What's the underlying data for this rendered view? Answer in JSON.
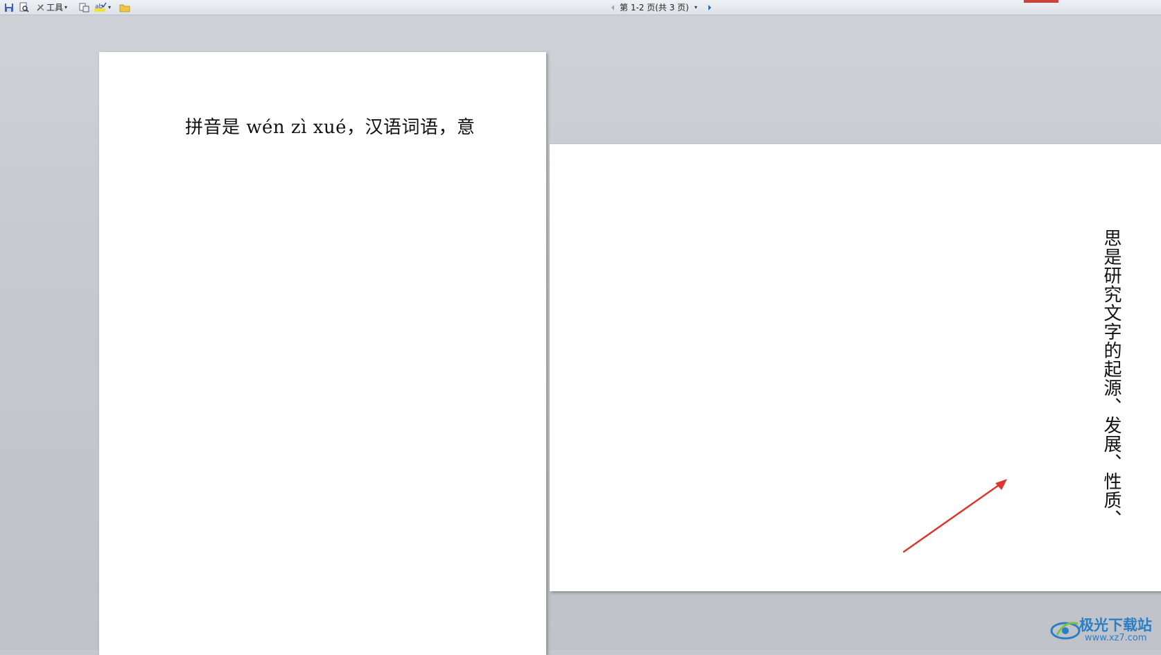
{
  "toolbar": {
    "tools_label": "工具",
    "page_nav_label": "第 1-2 页(共 3 页)",
    "accent_red": "#c9423b"
  },
  "pages": {
    "page1_text": "拼音是 wén zì xué，汉语词语，意",
    "page2_text": "思是研究文字的起源、发展、性质、"
  },
  "annotation": {
    "arrow_color": "#e0352b"
  },
  "watermark": {
    "title": "极光下载站",
    "url": "www.xz7.com"
  },
  "icons": [
    "save-icon",
    "print-preview-icon",
    "tools-icon",
    "zoom-icon",
    "spellcheck-icon",
    "folder-icon",
    "prev-page-icon",
    "next-page-icon"
  ]
}
